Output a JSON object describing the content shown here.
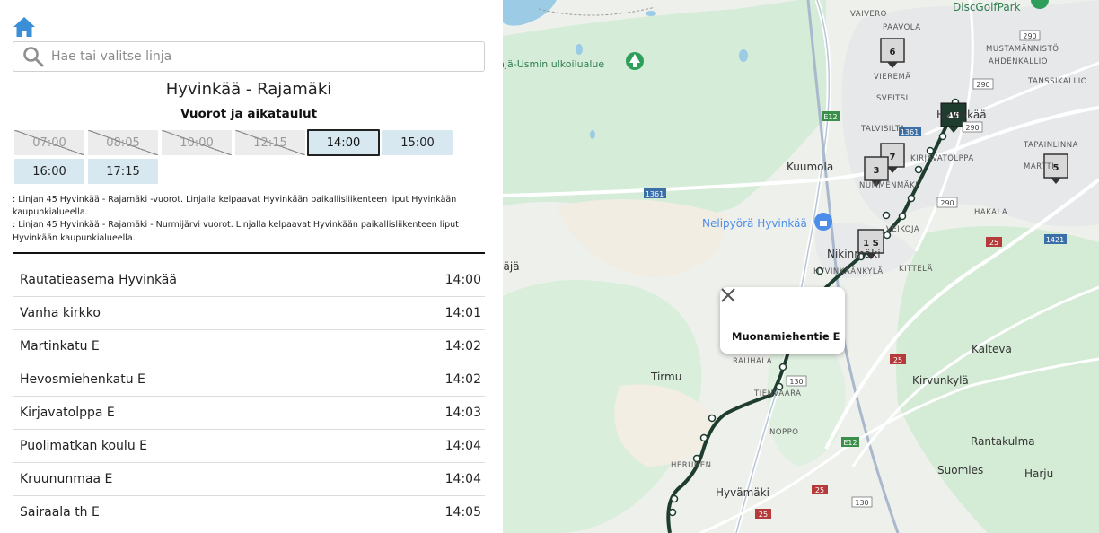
{
  "search": {
    "placeholder": "Hae tai valitse linja"
  },
  "route": {
    "title": "Hyvinkää - Rajamäki",
    "schedule_heading": "Vuorot ja aikataulut"
  },
  "departures": [
    {
      "time": "07:00",
      "state": "past"
    },
    {
      "time": "08:05",
      "state": "past"
    },
    {
      "time": "10:00",
      "state": "past"
    },
    {
      "time": "12:15",
      "state": "past"
    },
    {
      "time": "14:00",
      "state": "selected"
    },
    {
      "time": "15:00",
      "state": "future"
    },
    {
      "time": "16:00",
      "state": "future"
    },
    {
      "time": "17:15",
      "state": "future"
    }
  ],
  "notes": [
    ": Linjan 45 Hyvinkää - Rajamäki -vuorot. Linjalla kelpaavat Hyvinkään paikallisliikenteen liput Hyvinkään kaupunkialueella.",
    ": Linjan 45 Hyvinkää - Rajamäki - Nurmijärvi vuorot. Linjalla kelpaavat Hyvinkään paikallisliikenteen liput Hyvinkään kaupunkialueella."
  ],
  "stops": [
    {
      "name": "Rautatieasema Hyvinkää",
      "time": "14:00"
    },
    {
      "name": "Vanha kirkko",
      "time": "14:01"
    },
    {
      "name": "Martinkatu E",
      "time": "14:02"
    },
    {
      "name": "Hevosmiehenkatu E",
      "time": "14:02"
    },
    {
      "name": "Kirjavatolppa E",
      "time": "14:03"
    },
    {
      "name": "Puolimatkan koulu E",
      "time": "14:04"
    },
    {
      "name": "Kruununmaa E",
      "time": "14:04"
    },
    {
      "name": "Sairaala th E",
      "time": "14:05"
    }
  ],
  "map": {
    "popup_title": "Muonamiehentie E",
    "route_marker": "45",
    "route_markers": [
      "6",
      "7",
      "3",
      "5",
      "1 S"
    ],
    "labels": {
      "discgolf": "DiscGolfPark",
      "vaivero": "VAIVERO",
      "paavola": "PAAVOLA",
      "mustamannisto": "MUSTAMÄNNISTÖ",
      "ahdenkallio": "AHDENKALLIO",
      "tanssikallio": "TANSSIKALLIO",
      "vierema": "VIEREMÄ",
      "sveitsi": "SVEITSI",
      "talvisilta": "TALVISILTA",
      "hyvinkaa": "Hyvinkää",
      "tapainlinna": "TAPAINLINNA",
      "martti": "MARTTI",
      "kirjavatolppa": "KIRJAVATOLPPA",
      "kuumola": "Kuumola",
      "nummenmaki": "NUMMENMÄKI",
      "ulkoilualue": "Jäjä-Usmin ulkoilualue",
      "nelipyora": "Nelipyörä Hyvinkää",
      "veikoja": "VEIKOJA",
      "hakala": "HAKALA",
      "nikinmaki": "Nikinmäki",
      "hyvinkaankyla": "HYVINKÄÄNKYLÄ",
      "kittela": "KITTELÄ",
      "jaja": "Jäjä",
      "kalteva": "Kalteva",
      "rauhala": "RAUHALA",
      "tirmu": "Tirmu",
      "kirvunkyla": "Kirvunkylä",
      "tienvaara": "TIENVAARA",
      "noppo": "NOPPO",
      "rantakulma": "Rantakulma",
      "herunen": "HERUNEN",
      "suomies": "Suomies",
      "harju": "Harju",
      "hyvamaki": "Hyvämäki"
    },
    "road_shields": {
      "r290a": "290",
      "r290b": "290",
      "r290c": "290",
      "r290d": "290",
      "e12a": "E12",
      "e12b": "E12",
      "r1361a": "1361",
      "r1361b": "1361",
      "r25a": "25",
      "r25b": "25",
      "r25c": "25",
      "r25d": "25",
      "r1421": "1421",
      "r130a": "130",
      "r130b": "130"
    }
  }
}
